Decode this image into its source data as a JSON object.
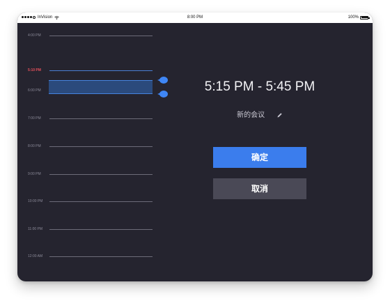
{
  "status_bar": {
    "carrier": "InVision",
    "time": "8:00 PM",
    "battery": "100%",
    "battery_level": 1.0
  },
  "timeline": {
    "hours": [
      {
        "label": "4:00 PM",
        "current": false
      },
      {
        "label": "5:10 PM",
        "current": true
      },
      {
        "label": "6:00 PM",
        "current": false
      },
      {
        "label": "7:00 PM",
        "current": false
      },
      {
        "label": "8:00 PM",
        "current": false
      },
      {
        "label": "9:00 PM",
        "current": false
      },
      {
        "label": "10:00 PM",
        "current": false
      },
      {
        "label": "11:00 PM",
        "current": false
      },
      {
        "label": "12:00 AM",
        "current": false
      }
    ],
    "current_time_color": "#e8505b",
    "selection_color": "#3f86f5"
  },
  "event": {
    "time_range": "5:15 PM - 5:45 PM",
    "name": "新的会议",
    "edit_icon": "pencil-icon"
  },
  "actions": {
    "confirm_label": "确定",
    "cancel_label": "取消",
    "confirm_color": "#3b7ded"
  }
}
